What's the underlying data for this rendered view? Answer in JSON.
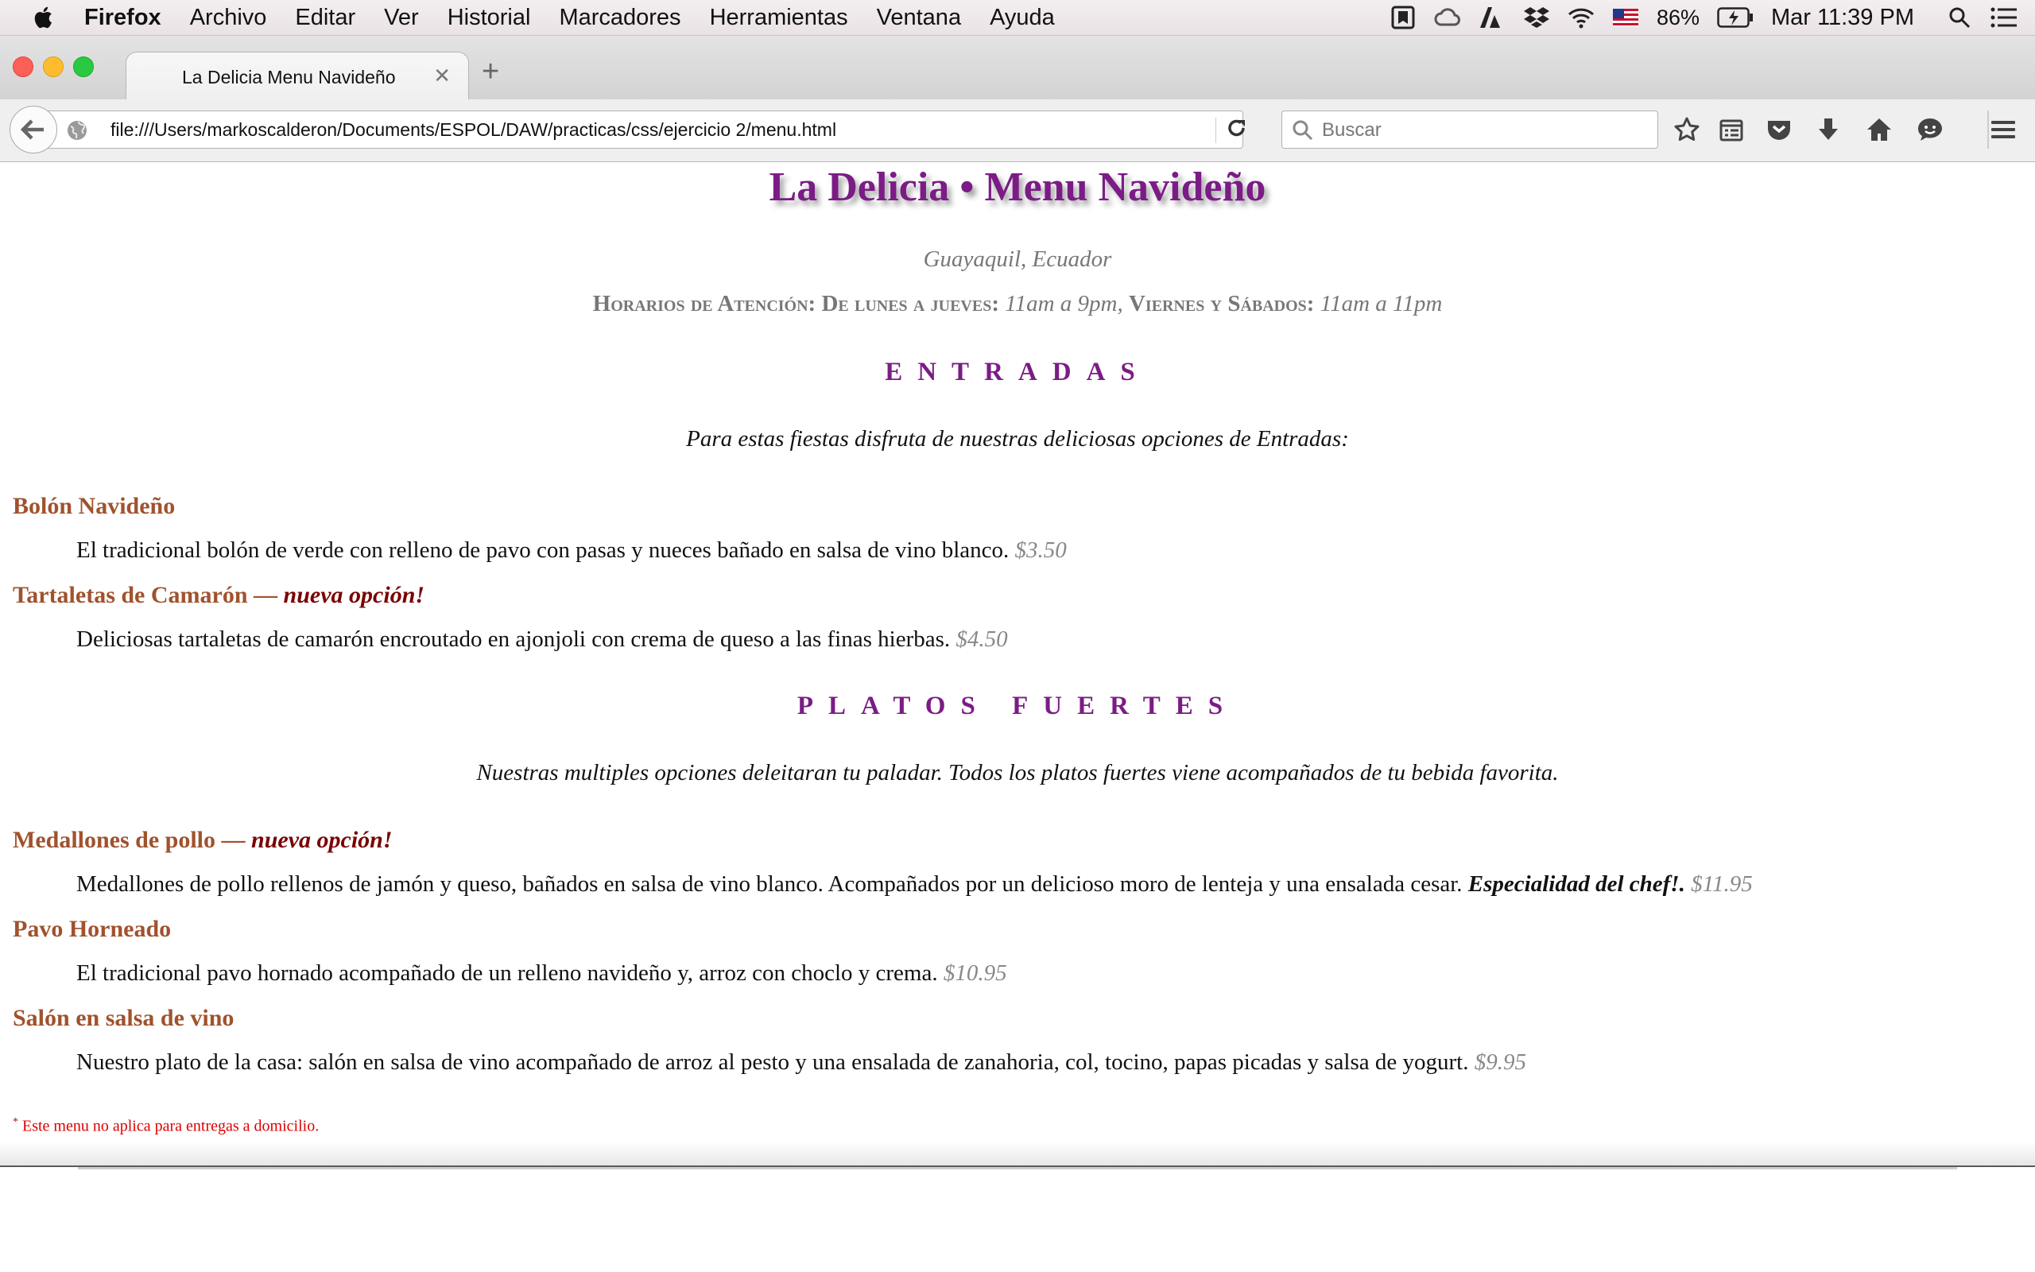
{
  "menubar": {
    "app_name": "Firefox",
    "items": [
      "Archivo",
      "Editar",
      "Ver",
      "Historial",
      "Marcadores",
      "Herramientas",
      "Ventana",
      "Ayuda"
    ],
    "battery": "86%",
    "clock": "Mar 11:39 PM"
  },
  "browser": {
    "tab_title": "La Delicia Menu Navideño",
    "url": "file:///Users/markoscalderon/Documents/ESPOL/DAW/practicas/css/ejercicio 2/menu.html",
    "search_placeholder": "Buscar"
  },
  "page": {
    "title": "La Delicia • Menu Navideño",
    "location": "Guayaquil, Ecuador",
    "hours": {
      "label1": "Horarios de Atención: De lunes a jueves:",
      "time1": "11am a 9pm,",
      "label2": "Viernes y Sábados:",
      "time2": "11am a 11pm"
    },
    "sections": [
      {
        "heading": "ENTRADAS",
        "intro": "Para estas fiestas disfruta de nuestras deliciosas opciones de Entradas:",
        "dishes": [
          {
            "name": "Bolón Navideño",
            "badge": "",
            "description": "El tradicional bolón de verde con relleno de pavo con pasas y nueces bañado en salsa de vino blanco.",
            "special": "",
            "price": "$3.50"
          },
          {
            "name": "Tartaletas de Camarón —",
            "badge": "nueva opción!",
            "description": "Deliciosas tartaletas de camarón encroutado en ajonjoli con crema de queso a las finas hierbas.",
            "special": "",
            "price": "$4.50"
          }
        ]
      },
      {
        "heading": "PLATOS FUERTES",
        "intro": "Nuestras multiples opciones deleitaran tu paladar. Todos los platos fuertes viene acompañados de tu bebida favorita.",
        "dishes": [
          {
            "name": "Medallones de pollo —",
            "badge": "nueva opción!",
            "description": "Medallones de pollo rellenos de jamón y queso, bañados en salsa de vino blanco. Acompañados por un delicioso moro de lenteja y una ensalada cesar.",
            "special": "Especialidad del chef!.",
            "price": "$11.95"
          },
          {
            "name": "Pavo Horneado",
            "badge": "",
            "description": "El tradicional pavo hornado acompañado de un relleno navideño y, arroz con choclo y crema.",
            "special": "",
            "price": "$10.95"
          },
          {
            "name": "Salón en salsa de vino",
            "badge": "",
            "description": "Nuestro plato de la casa: salón en salsa de vino acompañado de arroz al pesto y una ensalada de zanahoria, col, tocino, papas picadas y salsa de yogurt.",
            "special": "",
            "price": "$9.95"
          }
        ]
      }
    ],
    "footnote_mark": "*",
    "footnote": "Este menu no aplica para entregas a domicilio."
  },
  "colors": {
    "title": "#7b1c86",
    "dish_name": "#a0522d",
    "badge": "#7a0000",
    "price": "#888888",
    "footnote": "#dd0000"
  }
}
